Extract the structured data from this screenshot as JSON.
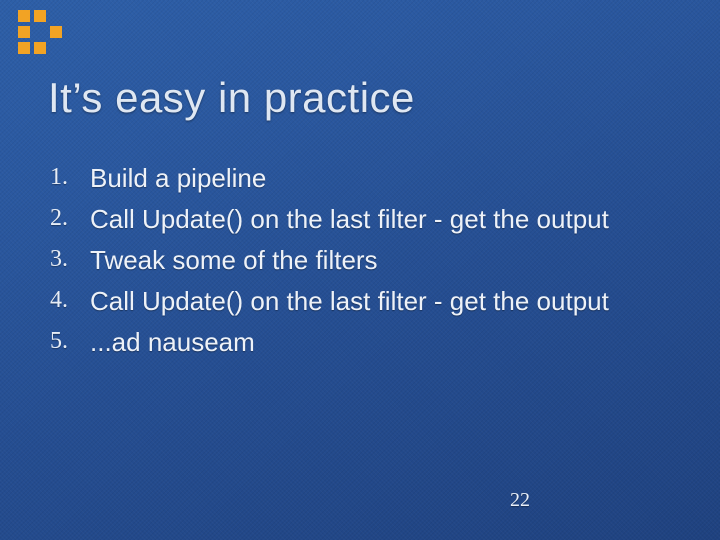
{
  "title": "It’s easy in practice",
  "items": [
    "Build a pipeline",
    "Call Update() on the last filter - get the output",
    "Tweak some of the filters",
    "Call Update() on the last filter - get the output",
    "...ad nauseam"
  ],
  "page_number": "22",
  "logo_pattern": [
    1,
    1,
    0,
    1,
    0,
    1,
    1,
    1,
    0
  ]
}
